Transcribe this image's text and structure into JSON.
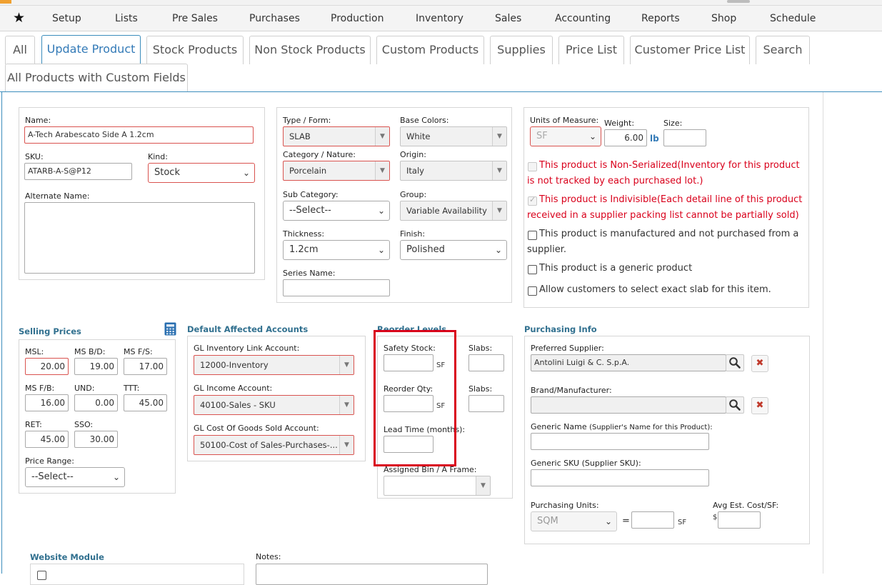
{
  "menu": {
    "star": "★",
    "items": [
      "Setup",
      "Lists",
      "Pre Sales",
      "Purchases",
      "Production",
      "Inventory",
      "Sales",
      "Accounting",
      "Reports",
      "Shop",
      "Schedule"
    ]
  },
  "tabs": [
    "All",
    "Update Product",
    "Stock Products",
    "Non Stock Products",
    "Custom Products",
    "Supplies",
    "Price List",
    "Customer Price List",
    "Search",
    "All Products with Custom Fields"
  ],
  "identity": {
    "name_label": "Name:",
    "name_value": "A-Tech Arabescato Side A 1.2cm",
    "sku_label": "SKU:",
    "sku_value": "ATARB-A-S@P12",
    "kind_label": "Kind:",
    "kind_value": "Stock",
    "alt_name_label": "Alternate Name:"
  },
  "classification": {
    "type_label": "Type / Form:",
    "type_value": "SLAB",
    "base_colors_label": "Base Colors:",
    "base_colors_value": "White",
    "category_label": "Category / Nature:",
    "category_value": "Porcelain",
    "origin_label": "Origin:",
    "origin_value": "Italy",
    "subcat_label": "Sub Category:",
    "subcat_value": "--Select--",
    "group_label": "Group:",
    "group_value": "Variable Availability",
    "thickness_label": "Thickness:",
    "thickness_value": "1.2cm",
    "finish_label": "Finish:",
    "finish_value": "Polished",
    "series_label": "Series Name:"
  },
  "measure": {
    "uom_label": "Units of Measure:",
    "uom_value": "SF",
    "weight_label": "Weight:",
    "weight_value": "6.00",
    "weight_unit": "lb",
    "size_label": "Size:",
    "flags": [
      {
        "text_line1": "This product is Non-Serialized(Inventory for this product",
        "text_line2": "is not tracked by each purchased lot.)",
        "checked": false
      },
      {
        "text_line1": "This product is Indivisible(Each detail line of this product",
        "text_line2": "received in a supplier packing list cannot be partially sold)",
        "checked": true
      },
      {
        "text_line1": "This product is manufactured and not purchased from a",
        "text_line2": "supplier.",
        "checked": false
      },
      {
        "text_line1": "This product is a generic product",
        "text_line2": "",
        "checked": false
      },
      {
        "text_line1": "Allow customers to select exact slab for this item.",
        "text_line2": "",
        "checked": false
      }
    ]
  },
  "selling": {
    "title": "Selling Prices",
    "icon": "calculator-icon",
    "msl_label": "MSL:",
    "msl_value": "20.00",
    "msbd_label": "MS B/D:",
    "msbd_value": "19.00",
    "msfs_label": "MS F/S:",
    "msfs_value": "17.00",
    "msfb_label": "MS F/B:",
    "msfb_value": "16.00",
    "und_label": "UND:",
    "und_value": "0.00",
    "ttt_label": "TTT:",
    "ttt_value": "45.00",
    "ret_label": "RET:",
    "ret_value": "45.00",
    "sso_label": "SSO:",
    "sso_value": "30.00",
    "price_range_label": "Price Range:",
    "price_range_value": "--Select--"
  },
  "accounts": {
    "title": "Default Affected Accounts",
    "inv_label": "GL Inventory Link Account:",
    "inv_value": "12000-Inventory",
    "income_label": "GL Income Account:",
    "income_value": "40100-Sales - SKU",
    "cogs_label": "GL Cost Of Goods Sold Account:",
    "cogs_value": "50100-Cost of Sales-Purchases-..."
  },
  "reorder": {
    "title": "Reorder Levels",
    "safety_label": "Safety Stock:",
    "sf1": "SF",
    "slabs1_label": "Slabs:",
    "reorder_label": "Reorder Qty:",
    "sf2": "SF",
    "slabs2_label": "Slabs:",
    "lead_label": "Lead Time (months):",
    "bin_label": "Assigned Bin / A Frame:"
  },
  "purchasing": {
    "title": "Purchasing Info",
    "supplier_label": "Preferred Supplier:",
    "supplier_value": "Antolini Luigi & C. S.p.A.",
    "brand_label": "Brand/Manufacturer:",
    "generic_name_label": "Generic Name",
    "generic_name_hint": "(Supplier's Name for this Product):",
    "generic_sku_label": "Generic SKU (Supplier SKU):",
    "units_label": "Purchasing Units:",
    "units_value": "SQM",
    "equals": "=",
    "units_sf": "SF",
    "avg_label": "Avg Est. Cost/SF:",
    "currency": "$"
  },
  "website": {
    "title": "Website Module",
    "notes_label": "Notes:"
  }
}
